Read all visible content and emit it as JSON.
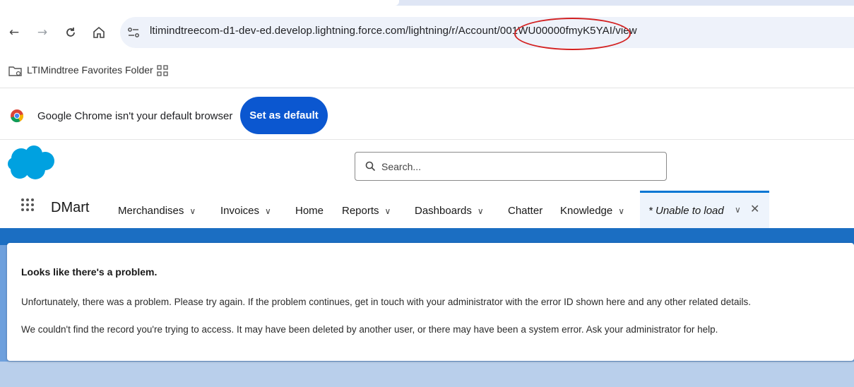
{
  "browser": {
    "url": "ltimindtreecom-d1-dev-ed.develop.lightning.force.com/lightning/r/Account/001WU00000fmyK5YAI/view",
    "bookmark_folder": "LTIMindtree Favorites Folder",
    "default_prompt": "Google Chrome isn't your default browser",
    "set_default_label": "Set as default"
  },
  "salesforce": {
    "search_placeholder": "Search...",
    "app_name": "DMart",
    "nav": [
      {
        "label": "Merchandises",
        "dropdown": true
      },
      {
        "label": "Invoices",
        "dropdown": true
      },
      {
        "label": "Home",
        "dropdown": false
      },
      {
        "label": "Reports",
        "dropdown": true
      },
      {
        "label": "Dashboards",
        "dropdown": true
      },
      {
        "label": "Chatter",
        "dropdown": false
      },
      {
        "label": "Knowledge",
        "dropdown": true
      }
    ],
    "active_tab": "* Unable to load"
  },
  "error": {
    "title": "Looks like there's a problem.",
    "line1": "Unfortunately, there was a problem. Please try again. If the problem continues, get in touch with your administrator with the error ID shown here and any other related details.",
    "line2": "We couldn't find the record you're trying to access. It may have been deleted by another user, or there may have been a system error. Ask your administrator for help."
  },
  "colors": {
    "salesforce_blue": "#0176d3",
    "cloud_blue": "#00a1e0",
    "chrome_button": "#0b57d0",
    "annotation_red": "#d32020"
  },
  "icons": [
    "back-icon",
    "forward-icon",
    "reload-icon",
    "home-icon",
    "site-info-icon",
    "folder-icon",
    "apps-grid-icon",
    "chrome-logo-icon",
    "salesforce-cloud-logo",
    "search-icon",
    "app-launcher-icon",
    "chevron-down-icon",
    "close-icon"
  ]
}
